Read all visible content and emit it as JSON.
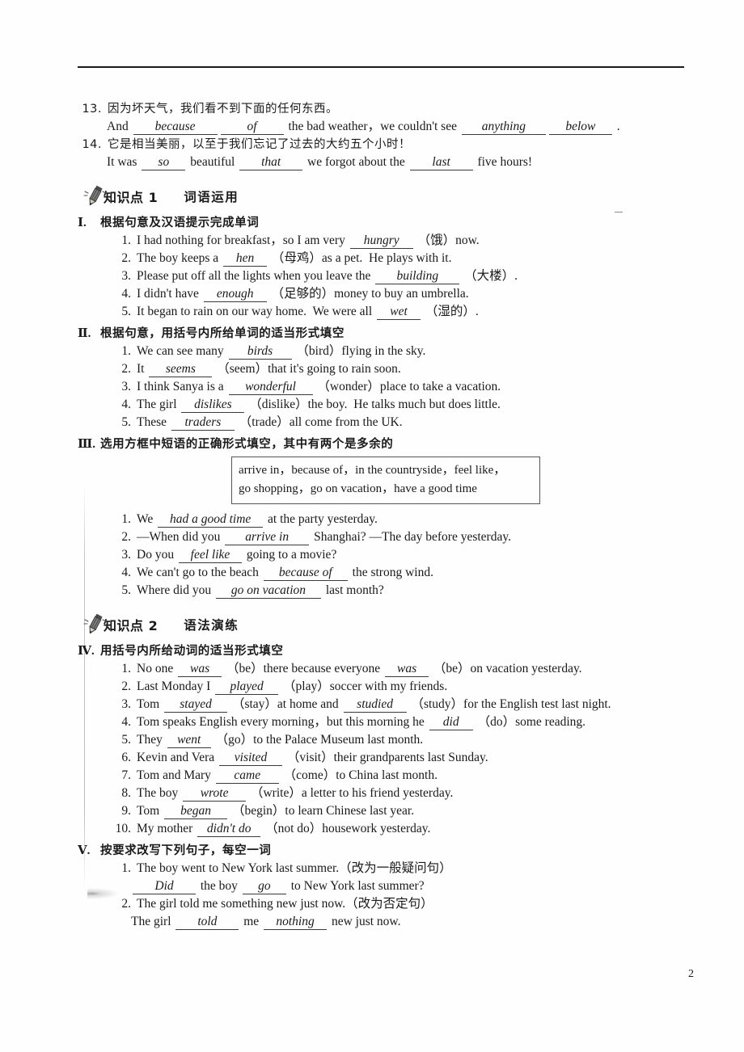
{
  "page": {
    "number": "2"
  },
  "top_items": [
    {
      "num": "13.",
      "chinese": "因为坏天气，我们看不到下面的任何东西。",
      "pre": "And",
      "parts": [
        {
          "blank": "because",
          "size": "w-lg"
        },
        {
          "blank": "of",
          "size": "w-md"
        },
        {
          "text": " the bad weather，we couldn't see "
        },
        {
          "blank": "anything",
          "size": "w-lg"
        },
        {
          "blank": "below",
          "size": "w-md"
        },
        {
          "text": " ."
        }
      ]
    },
    {
      "num": "14.",
      "chinese": "它是相当美丽，以至于我们忘记了过去的大约五个小时！",
      "pre": "It was",
      "parts": [
        {
          "blank": "so",
          "size": "w-sm"
        },
        {
          "text": " beautiful "
        },
        {
          "blank": "that",
          "size": "w-md"
        },
        {
          "text": " we forgot about the "
        },
        {
          "blank": "last",
          "size": "w-md"
        },
        {
          "text": " five hours!"
        }
      ]
    }
  ],
  "kp1": {
    "label": "知识点",
    "number": "1",
    "subtitle": "词语运用"
  },
  "kp2": {
    "label": "知识点",
    "number": "2",
    "subtitle": "语法演练"
  },
  "section_1": {
    "roman": "Ⅰ.",
    "title": "根据句意及汉语提示完成单词",
    "items": [
      {
        "num": "1.",
        "pre": "I had nothing for breakfast，so I am very ",
        "blank": "hungry",
        "size": "w-md",
        "post": " （饿）now."
      },
      {
        "num": "2.",
        "pre": "The boy keeps a ",
        "blank": "hen",
        "size": "w-sm",
        "post": " （母鸡）as a pet.  He plays with it."
      },
      {
        "num": "3.",
        "pre": "Please put off all the lights when you leave the ",
        "blank": "building",
        "size": "w-lg",
        "post": " （大楼）."
      },
      {
        "num": "4.",
        "pre": "I didn't have ",
        "blank": "enough",
        "size": "w-md",
        "post": " （足够的）money to buy an umbrella."
      },
      {
        "num": "5.",
        "pre": "It began to rain on our way home.  We were all ",
        "blank": "wet",
        "size": "w-sm",
        "post": " （湿的）."
      }
    ]
  },
  "section_2": {
    "roman": "Ⅱ.",
    "title": "根据句意，用括号内所给单词的适当形式填空",
    "items": [
      {
        "num": "1.",
        "pre": "We can see many ",
        "blank": "birds",
        "size": "w-md",
        "post": " （bird）flying in the sky."
      },
      {
        "num": "2.",
        "pre": "It ",
        "blank": "seems",
        "size": "w-md",
        "post": " （seem）that it's going to rain soon."
      },
      {
        "num": "3.",
        "pre": "I think Sanya is a ",
        "blank": "wonderful",
        "size": "w-lg",
        "post": " （wonder）place to take a vacation."
      },
      {
        "num": "4.",
        "pre": "The girl ",
        "blank": "dislikes",
        "size": "w-md",
        "post": " （dislike）the boy.  He talks much but does little."
      },
      {
        "num": "5.",
        "pre": "These ",
        "blank": "traders",
        "size": "w-md",
        "post": " （trade）all come from the UK."
      }
    ]
  },
  "section_3": {
    "roman": "Ⅲ.",
    "title": "选用方框中短语的正确形式填空，其中有两个是多余的",
    "phrase_box": [
      "arrive in，because of，in the countryside，feel like，",
      "go shopping，go on vacation，have a good time"
    ],
    "items": [
      {
        "num": "1.",
        "pre": "We ",
        "blank": "had a good time",
        "size": "w-xl",
        "post": " at the party yesterday."
      },
      {
        "num": "2.",
        "pre": "—When did you ",
        "blank": "arrive in",
        "size": "w-lg",
        "post": " Shanghai? —The day before yesterday."
      },
      {
        "num": "3.",
        "pre": "Do you ",
        "blank": "feel like",
        "size": "w-md",
        "post": " going to a movie?"
      },
      {
        "num": "4.",
        "pre": "We can't go to the beach ",
        "blank": "because of",
        "size": "w-lg",
        "post": " the strong wind."
      },
      {
        "num": "5.",
        "pre": "Where did you ",
        "blank": "go on vacation",
        "size": "w-xl",
        "post": " last month?"
      }
    ]
  },
  "section_4": {
    "roman": "Ⅳ.",
    "title": "用括号内所给动词的适当形式填空",
    "items": [
      {
        "num": "1.",
        "pre": "No one ",
        "blank": "was",
        "size": "w-sm",
        "mid": " （be）there because everyone ",
        "blank2": "was",
        "size2": "w-sm",
        "post": " （be）on vacation yesterday."
      },
      {
        "num": "2.",
        "pre": "Last Monday I ",
        "blank": "played",
        "size": "w-md",
        "post": " （play）soccer with my friends."
      },
      {
        "num": "3.",
        "pre": "Tom ",
        "blank": "stayed",
        "size": "w-md",
        "mid": " （stay）at home and ",
        "blank2": "studied",
        "size2": "w-md",
        "post": " （study）for the English test last night."
      },
      {
        "num": "4.",
        "pre": "Tom speaks English every morning，but this morning he ",
        "blank": "did",
        "size": "w-sm",
        "post": " （do）some reading."
      },
      {
        "num": "5.",
        "pre": "They ",
        "blank": "went",
        "size": "w-sm",
        "post": " （go）to the Palace Museum last month."
      },
      {
        "num": "6.",
        "pre": "Kevin and Vera ",
        "blank": "visited",
        "size": "w-md",
        "post": " （visit）their grandparents last Sunday."
      },
      {
        "num": "7.",
        "pre": "Tom and Mary ",
        "blank": "came",
        "size": "w-md",
        "post": " （come）to China last month."
      },
      {
        "num": "8.",
        "pre": "The boy ",
        "blank": "wrote",
        "size": "w-md",
        "post": " （write）a letter to his friend yesterday."
      },
      {
        "num": "9.",
        "pre": "Tom ",
        "blank": "began",
        "size": "w-md",
        "post": " （begin）to learn Chinese last year."
      },
      {
        "num": "10.",
        "pre": "My mother ",
        "blank": "didn't do",
        "size": "w-md",
        "post": " （not do）housework yesterday."
      }
    ]
  },
  "section_5": {
    "roman": "Ⅴ.",
    "title": "按要求改写下列句子，每空一词",
    "items": [
      {
        "num": "1.",
        "prompt": "The boy went to New York last summer.（改为一般疑问句）",
        "answer_parts": [
          {
            "blank": "Did",
            "size": "w-md"
          },
          {
            "text": " the boy "
          },
          {
            "blank": "go",
            "size": "w-sm"
          },
          {
            "text": " to New York last summer?"
          }
        ]
      },
      {
        "num": "2.",
        "prompt": "The girl told me something new just now.（改为否定句）",
        "answer_parts": [
          {
            "text": "The girl "
          },
          {
            "blank": "told",
            "size": "w-md"
          },
          {
            "text": " me "
          },
          {
            "blank": "nothing",
            "size": "w-md"
          },
          {
            "text": " new just now."
          }
        ]
      }
    ]
  }
}
